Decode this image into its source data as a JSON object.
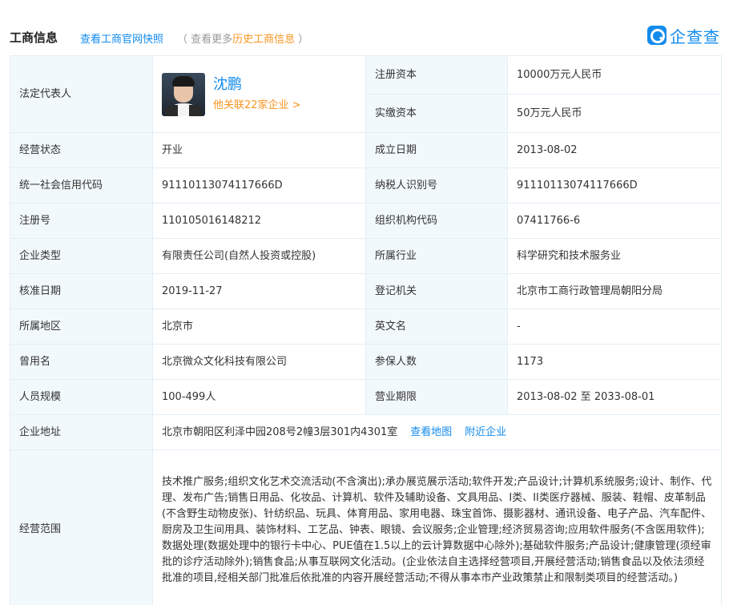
{
  "header": {
    "title": "工商信息",
    "snapshot_link": "查看工商官网快照",
    "history_prefix": "（ 查看更多",
    "history_link": "历史工商信息",
    "history_suffix": " ）",
    "logo_text": "企查查"
  },
  "legal_rep": {
    "label": "法定代表人",
    "name": "沈鹏",
    "related": "他关联22家企业 >"
  },
  "rows": {
    "reg_capital": {
      "label": "注册资本",
      "value": "10000万元人民币"
    },
    "paid_capital": {
      "label": "实缴资本",
      "value": "50万元人民币"
    },
    "status": {
      "label": "经营状态",
      "value": "开业"
    },
    "founded": {
      "label": "成立日期",
      "value": "2013-08-02"
    },
    "credit_code": {
      "label": "统一社会信用代码",
      "value": "91110113074117666D"
    },
    "taxpayer_id": {
      "label": "纳税人识别号",
      "value": "91110113074117666D"
    },
    "reg_no": {
      "label": "注册号",
      "value": "110105016148212"
    },
    "org_code": {
      "label": "组织机构代码",
      "value": "07411766-6"
    },
    "company_type": {
      "label": "企业类型",
      "value": "有限责任公司(自然人投资或控股)"
    },
    "industry": {
      "label": "所属行业",
      "value": "科学研究和技术服务业"
    },
    "approved": {
      "label": "核准日期",
      "value": "2019-11-27"
    },
    "authority": {
      "label": "登记机关",
      "value": "北京市工商行政管理局朝阳分局"
    },
    "region": {
      "label": "所属地区",
      "value": "北京市"
    },
    "english_name": {
      "label": "英文名",
      "value": "-"
    },
    "former_name": {
      "label": "曾用名",
      "value": "北京微众文化科技有限公司"
    },
    "insured": {
      "label": "参保人数",
      "value": "1173"
    },
    "staff_size": {
      "label": "人员规模",
      "value": "100-499人"
    },
    "term": {
      "label": "营业期限",
      "value": "2013-08-02 至 2033-08-01"
    },
    "address": {
      "label": "企业地址",
      "value": "北京市朝阳区利泽中园208号2幢3层301内4301室",
      "map_link": "查看地图",
      "nearby_link": "附近企业"
    },
    "scope": {
      "label": "经营范围",
      "value": "技术推广服务;组织文化艺术交流活动(不含演出);承办展览展示活动;软件开发;产品设计;计算机系统服务;设计、制作、代理、发布广告;销售日用品、化妆品、计算机、软件及辅助设备、文具用品、I类、II类医疗器械、服装、鞋帽、皮革制品(不含野生动物皮张)、针纺织品、玩具、体育用品、家用电器、珠宝首饰、摄影器材、通讯设备、电子产品、汽车配件、厨房及卫生间用具、装饰材料、工艺品、钟表、眼镜、会议服务;企业管理;经济贸易咨询;应用软件服务(不含医用软件);数据处理(数据处理中的银行卡中心、PUE值在1.5以上的云计算数据中心除外);基础软件服务;产品设计;健康管理(须经审批的诊疗活动除外);销售食品;从事互联网文化活动。(企业依法自主选择经营项目,开展经营活动;销售食品以及依法须经批准的项目,经相关部门批准后依批准的内容开展经营活动;不得从事本市产业政策禁止和限制类项目的经营活动。)"
    }
  }
}
